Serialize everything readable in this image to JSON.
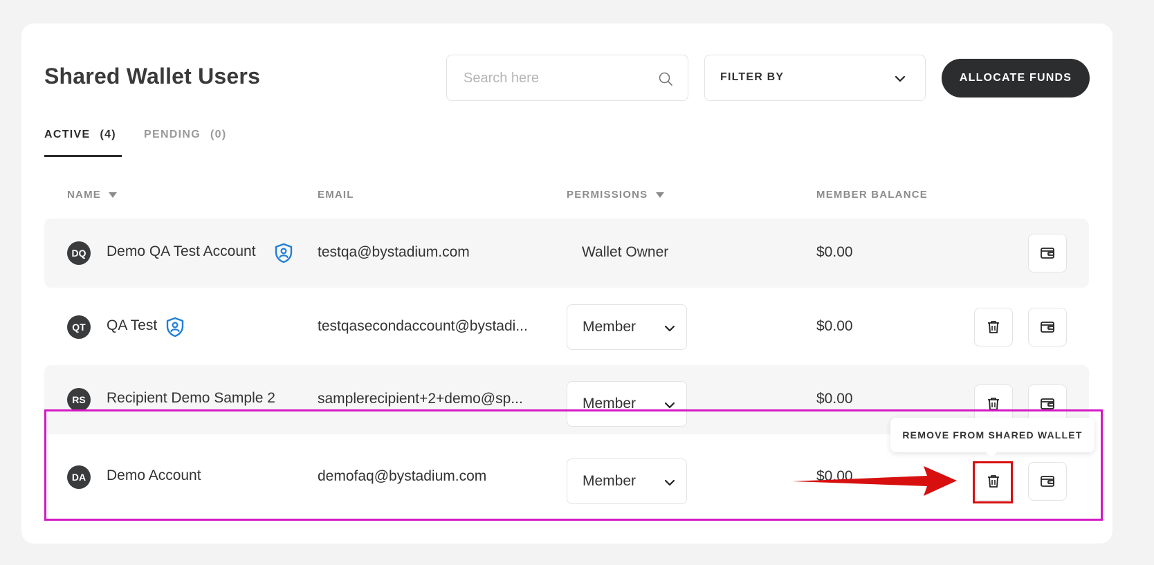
{
  "page": {
    "title": "Shared Wallet Users"
  },
  "search": {
    "placeholder": "Search here"
  },
  "filter": {
    "label": "FILTER BY"
  },
  "actions": {
    "allocate_label": "ALLOCATE FUNDS"
  },
  "tabs": [
    {
      "label": "ACTIVE",
      "count": "(4)"
    },
    {
      "label": "PENDING",
      "count": "(0)"
    }
  ],
  "columns": {
    "name": "NAME",
    "email": "EMAIL",
    "permissions": "PERMISSIONS",
    "balance": "MEMBER BALANCE"
  },
  "rows": [
    {
      "initials": "DQ",
      "name": "Demo QA Test Account",
      "email": "testqa@bystadium.com",
      "permission": "Wallet Owner",
      "balance": "$0.00"
    },
    {
      "initials": "QT",
      "name": "QA Test",
      "email": "testqasecondaccount@bystadi...",
      "permission": "Member",
      "balance": "$0.00"
    },
    {
      "initials": "RS",
      "name": "Recipient Demo Sample 2",
      "email": "samplerecipient+2+demo@sp...",
      "permission": "Member",
      "balance": "$0.00"
    },
    {
      "initials": "DA",
      "name": "Demo Account",
      "email": "demofaq@bystadium.com",
      "permission": "Member",
      "balance": "$0.00"
    }
  ],
  "tooltip": {
    "text": "REMOVE FROM SHARED WALLET"
  },
  "colors": {
    "accent": "#2b2d2f",
    "shield": "#1e7fd8",
    "highlight": "#d418c4",
    "annotation": "#d80f0f"
  }
}
